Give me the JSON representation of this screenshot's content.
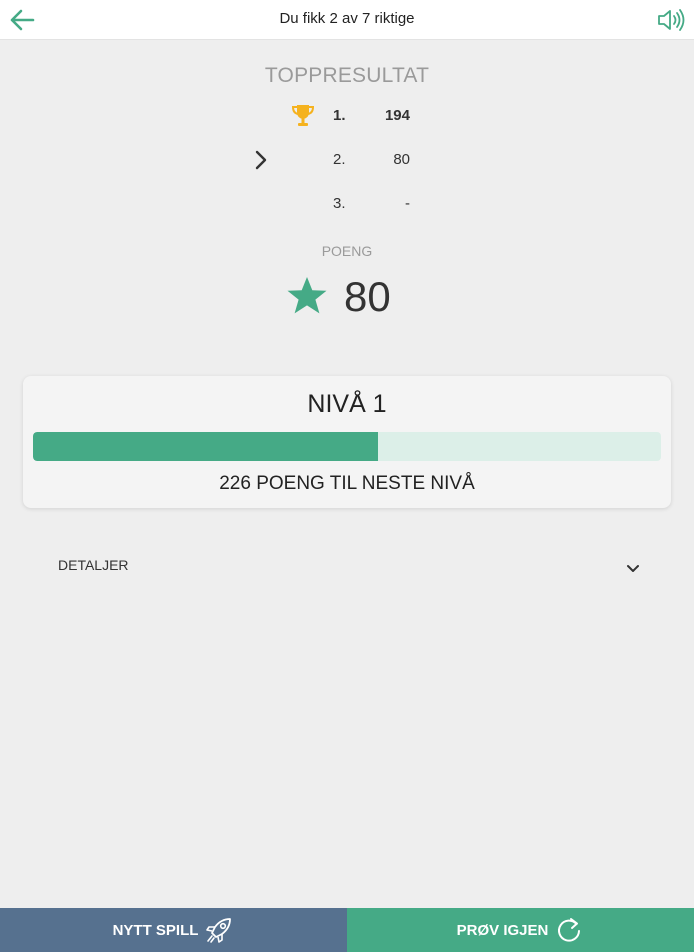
{
  "header": {
    "title": "Du fikk 2 av 7 riktige",
    "back_icon": "arrow-left-icon",
    "sound_icon": "speaker-icon"
  },
  "leaderboard": {
    "title": "TOPPRESULTAT",
    "entries": [
      {
        "rank": "1.",
        "score": "194"
      },
      {
        "rank": "2.",
        "score": "80"
      },
      {
        "rank": "3.",
        "score": "-"
      }
    ]
  },
  "points": {
    "label": "POENG",
    "value": "80"
  },
  "level": {
    "title": "NIVÅ 1",
    "progress_fraction": 0.55,
    "remaining_text": "226 POENG TIL NESTE NIVÅ"
  },
  "details": {
    "label": "DETALJER"
  },
  "footer": {
    "new_game_label": "NYTT SPILL",
    "retry_label": "PRØV IGJEN"
  },
  "colors": {
    "accent": "#45aa86",
    "new_game_bg": "#56718f",
    "trophy": "#f5b21e",
    "progress_track": "#dcefe8"
  }
}
